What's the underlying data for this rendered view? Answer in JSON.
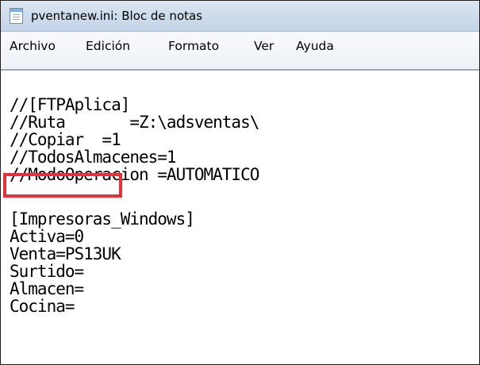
{
  "window": {
    "title": "pventanew.ini: Bloc de notas"
  },
  "menu": {
    "items": [
      {
        "label": "Archivo"
      },
      {
        "label": "Edición"
      },
      {
        "label": "Formato"
      },
      {
        "label": "Ver"
      },
      {
        "label": "Ayuda"
      }
    ]
  },
  "editor": {
    "lines": [
      "//[FTPAplica]",
      "//Ruta       =Z:\\adsventas\\",
      "//Copiar  =1",
      "//TodosAlmacenes=1",
      "//ModoOperacion =AUTOMATICO",
      "",
      "[Impresoras_Windows]",
      "Activa=0",
      "Venta=PS13UK",
      "Surtido=",
      "Almacen=",
      "Cocina="
    ]
  },
  "annotation": {
    "highlight_color": "#e0333c",
    "highlighted_line": "Activa=0"
  }
}
